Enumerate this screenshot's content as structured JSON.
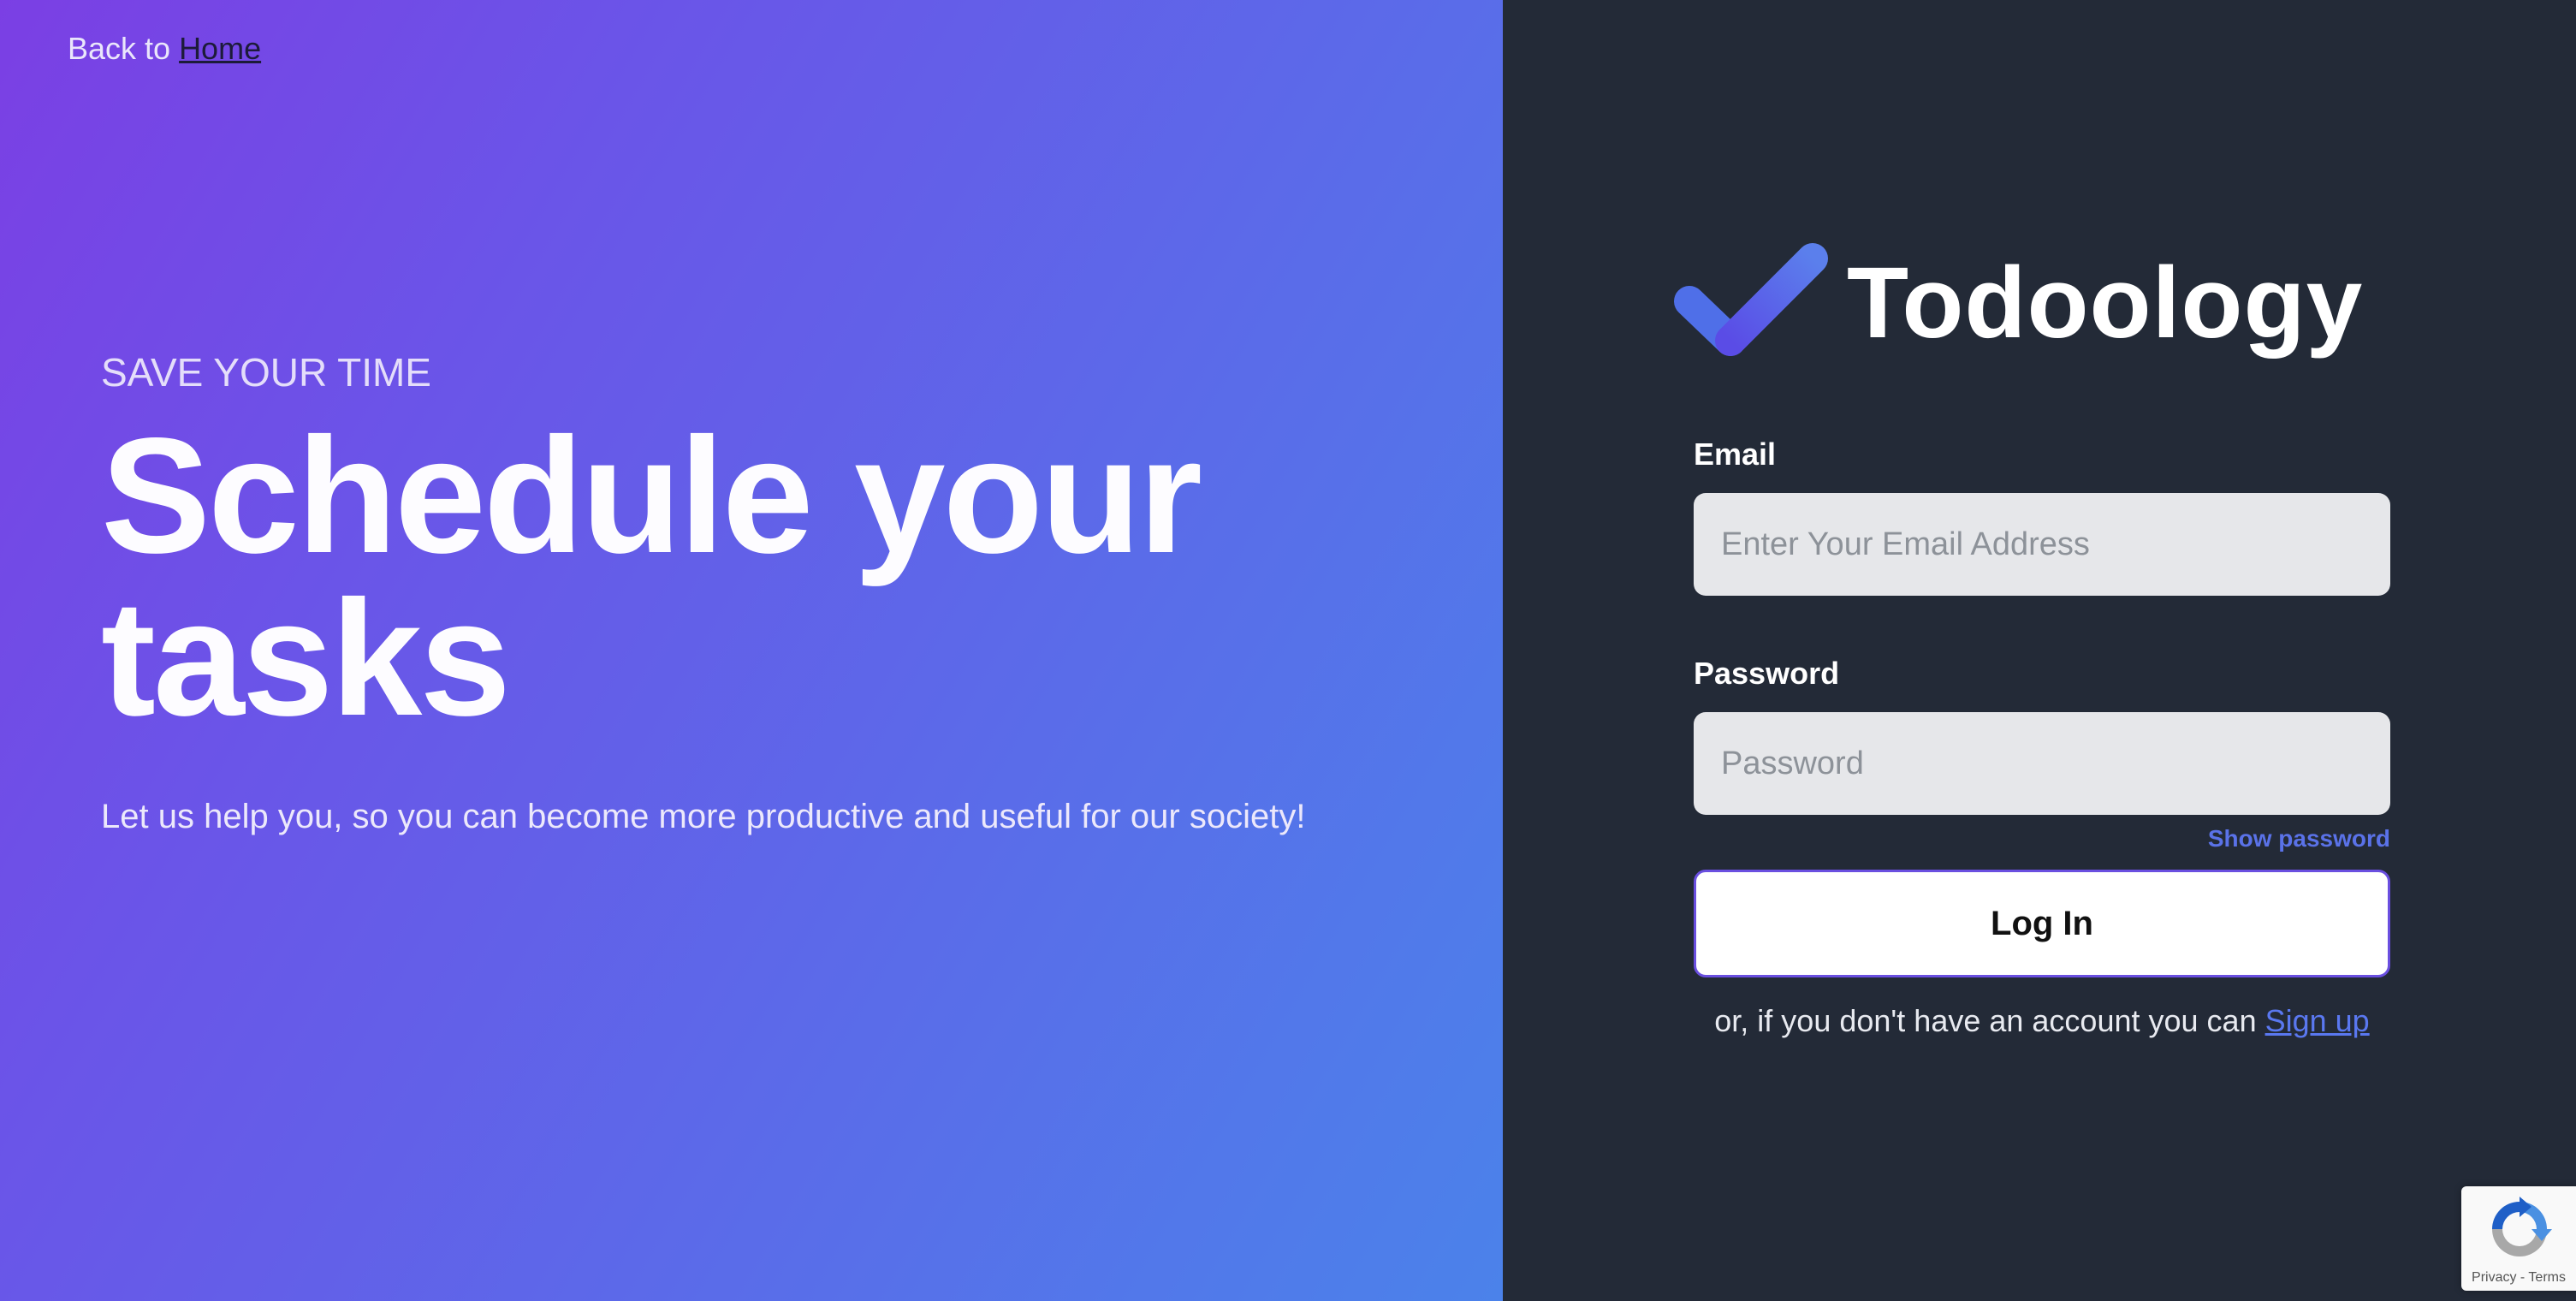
{
  "back_link": {
    "prefix": "Back to ",
    "link": "Home"
  },
  "hero": {
    "eyebrow": "SAVE YOUR TIME",
    "headline_line1": "Schedule your",
    "headline_line2": "tasks",
    "tagline": "Let us help you, so you can become more productive and useful for our society!"
  },
  "brand": {
    "name": "Todoology",
    "logo_icon": "checkmark-icon",
    "accent": "#5a6ce9"
  },
  "form": {
    "email_label": "Email",
    "email_placeholder": "Enter Your Email Address",
    "email_value": "",
    "password_label": "Password",
    "password_placeholder": "Password",
    "password_value": "",
    "show_password": "Show password",
    "submit": "Log In",
    "signup_prefix": "or, if you don't have an account you can ",
    "signup_link": "Sign up"
  },
  "recaptcha": {
    "icon": "recaptcha-icon",
    "text": "Privacy - Terms"
  },
  "colors": {
    "gradient_start": "#7b3fe4",
    "gradient_end": "#4b82ea",
    "panel_dark": "#232a37",
    "link_blue": "#5a78f0"
  }
}
